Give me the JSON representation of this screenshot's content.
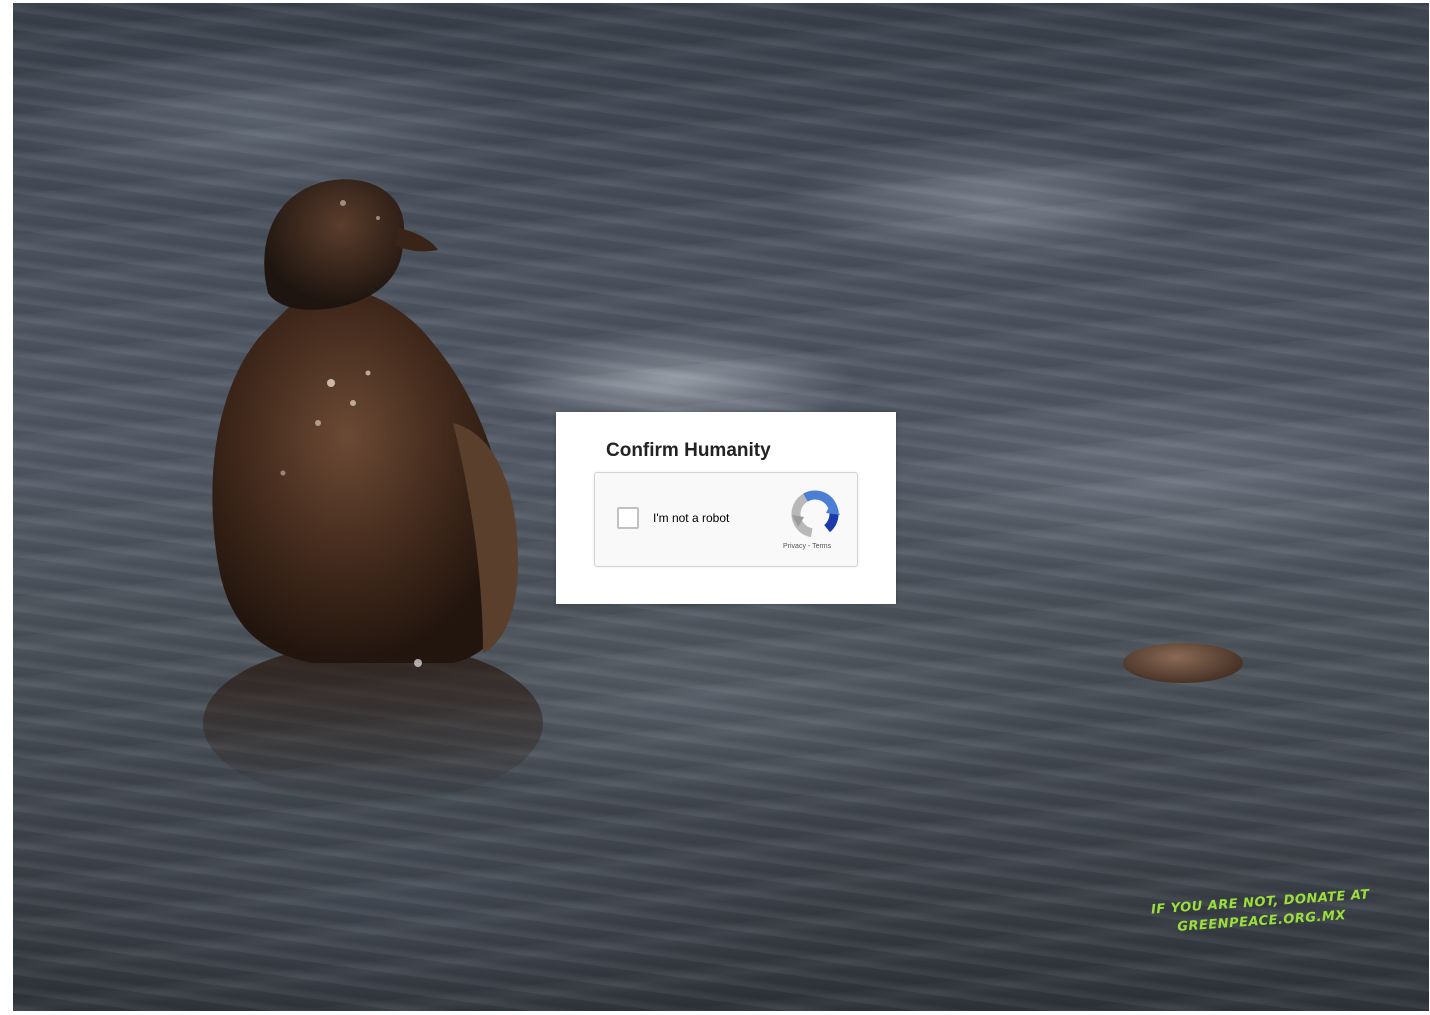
{
  "captcha": {
    "title": "Confirm Humanity",
    "checkbox_label": "I'm not a robot",
    "checkbox_checked": false,
    "privacy_link": "Privacy",
    "terms_link": "Terms",
    "logo_icon": "recaptcha-icon"
  },
  "ad": {
    "tagline_line1": "IF YOU ARE NOT, DONATE AT",
    "tagline_line2": "GREENPEACE.ORG.MX",
    "tagline_color": "#9be03a"
  }
}
